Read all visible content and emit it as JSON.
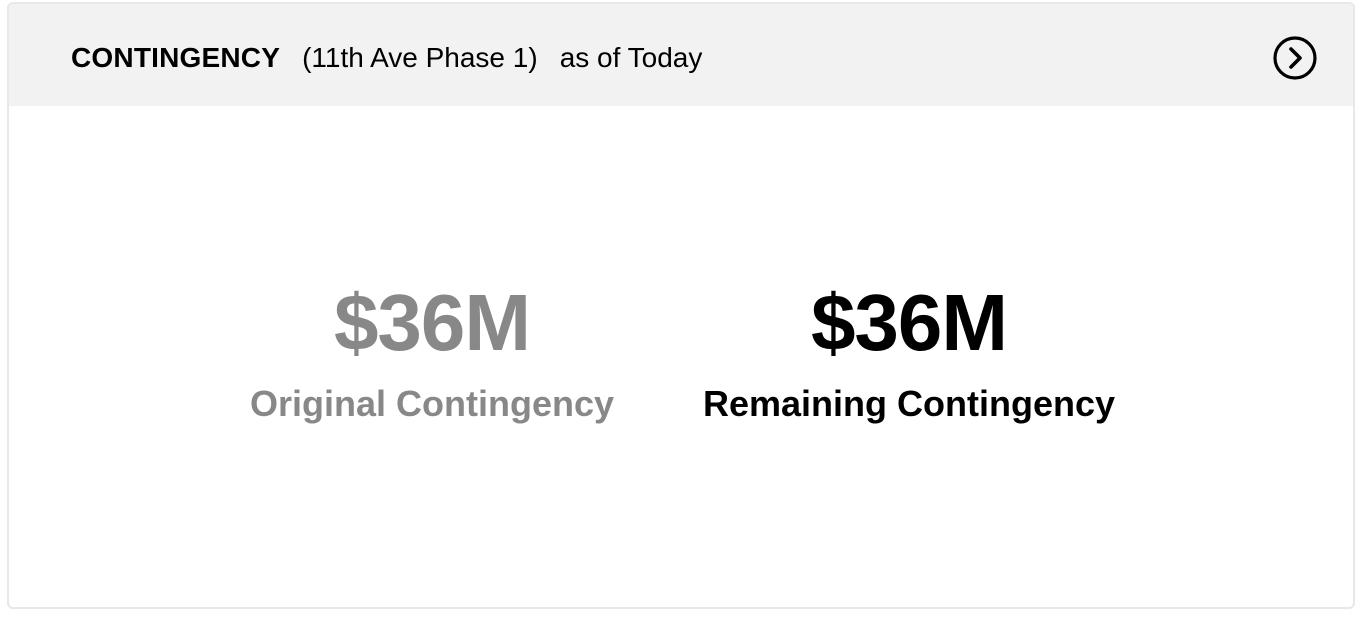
{
  "header": {
    "title": "CONTINGENCY",
    "project": "(11th Ave Phase 1)",
    "as_of": "as of Today",
    "nav_icon": "chevron-right-circle-icon"
  },
  "metrics": {
    "original": {
      "value": "$36M",
      "label": "Original Contingency",
      "color": "#888888"
    },
    "remaining": {
      "value": "$36M",
      "label": "Remaining Contingency",
      "color": "#000000"
    }
  },
  "colors": {
    "header_background": "#f2f2f2",
    "card_border": "#e8e8e8",
    "card_background": "#ffffff"
  }
}
